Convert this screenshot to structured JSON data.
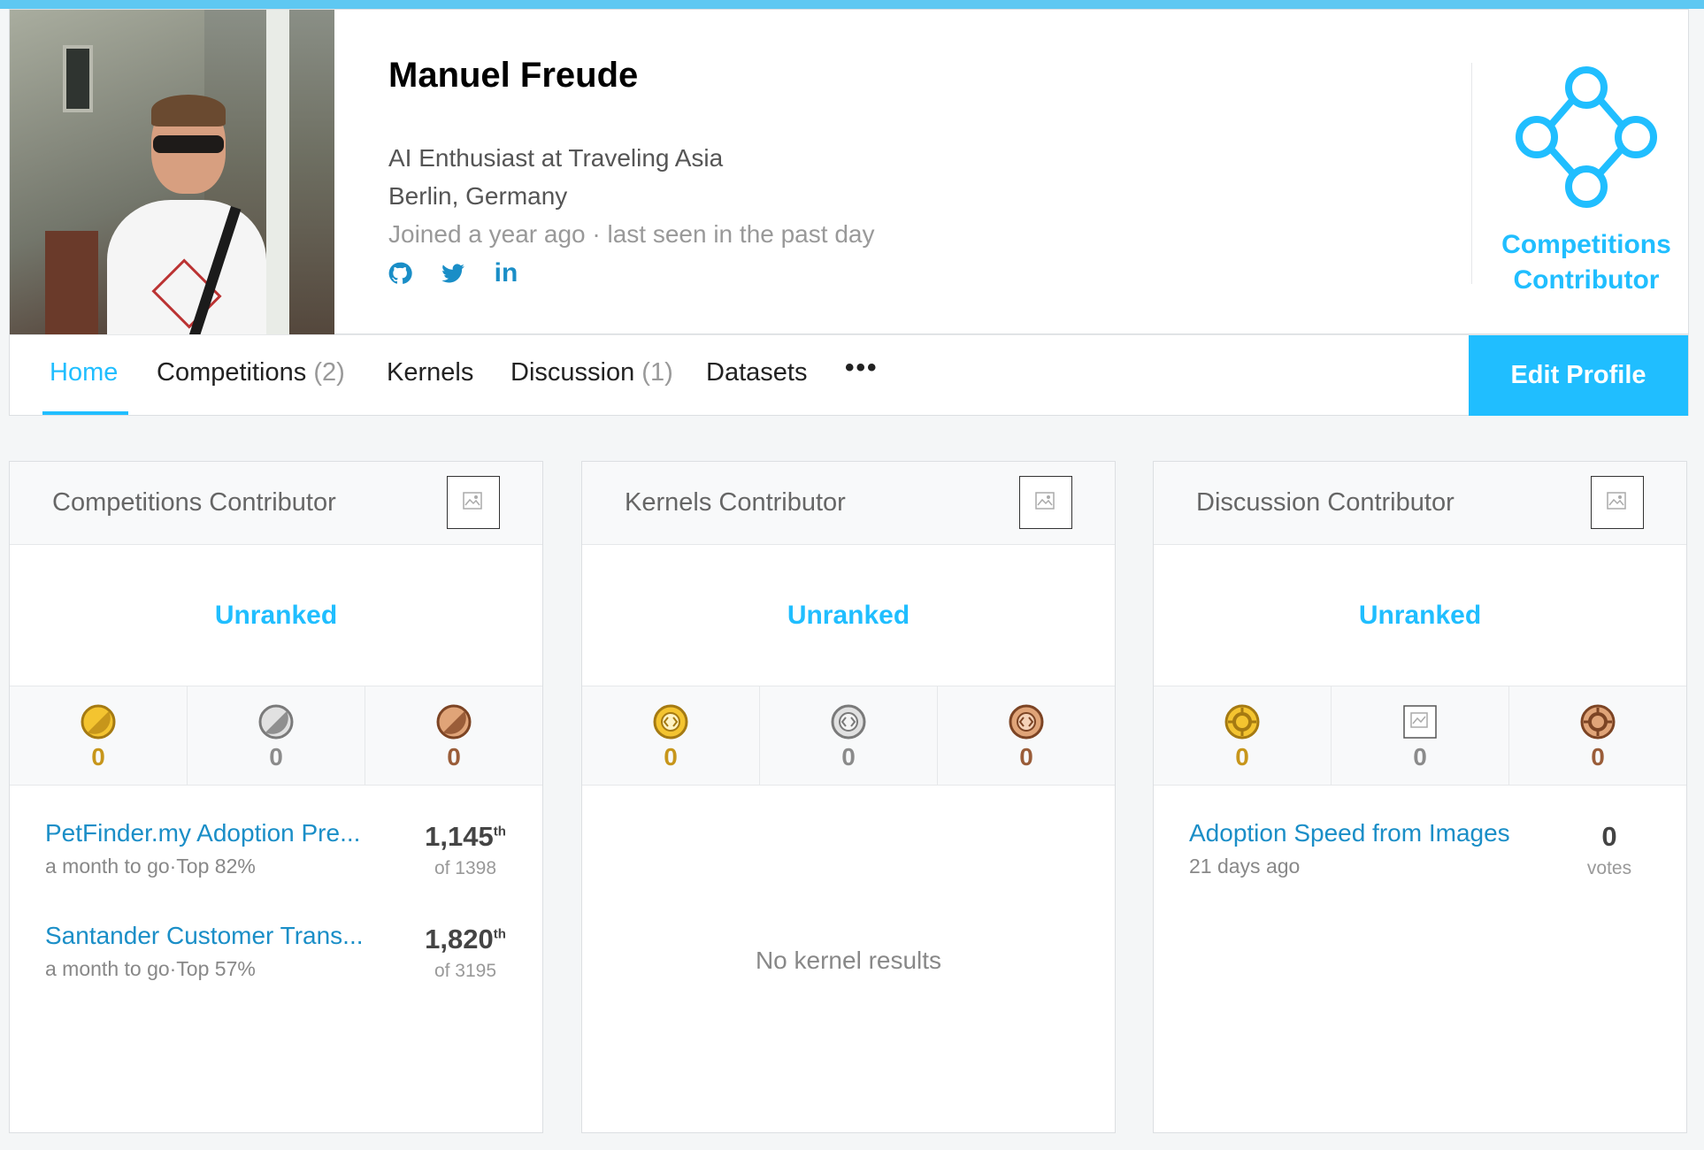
{
  "profile": {
    "name": "Manuel Freude",
    "occupation": "AI Enthusiast at Traveling Asia",
    "location": "Berlin, Germany",
    "joined": "Joined a year ago · last seen in the past day",
    "socials": [
      "github-icon",
      "twitter-icon",
      "linkedin-icon"
    ],
    "linkedin_glyph": "in",
    "tier_label": "Competitions Contributor"
  },
  "nav": {
    "home": "Home",
    "competitions": "Competitions",
    "competitions_count": "(2)",
    "kernels": "Kernels",
    "discussion": "Discussion",
    "discussion_count": "(1)",
    "datasets": "Datasets",
    "more": "•••",
    "edit_profile": "Edit Profile"
  },
  "cards": {
    "competitions": {
      "title": "Competitions Contributor",
      "rank": "Unranked",
      "medals": {
        "gold": "0",
        "silver": "0",
        "bronze": "0"
      },
      "entries": [
        {
          "title": "PetFinder.my Adoption Pre...",
          "sub": "a month to go·Top 82%",
          "rank": "1,145",
          "suffix": "th",
          "of": "of 1398"
        },
        {
          "title": "Santander Customer Trans...",
          "sub": "a month to go·Top 57%",
          "rank": "1,820",
          "suffix": "th",
          "of": "of 3195"
        }
      ]
    },
    "kernels": {
      "title": "Kernels Contributor",
      "rank": "Unranked",
      "medals": {
        "gold": "0",
        "silver": "0",
        "bronze": "0"
      },
      "empty": "No kernel results"
    },
    "discussion": {
      "title": "Discussion Contributor",
      "rank": "Unranked",
      "medals": {
        "gold": "0",
        "silver": "0",
        "bronze": "0"
      },
      "entries": [
        {
          "title": "Adoption Speed from Images",
          "sub": "21 days ago",
          "votes": "0",
          "votes_label": "votes"
        }
      ]
    }
  },
  "colors": {
    "accent": "#20beff",
    "link": "#1a8ec7",
    "gold": "#c7961b",
    "silver": "#8b8b8b",
    "bronze": "#9a5d39"
  }
}
